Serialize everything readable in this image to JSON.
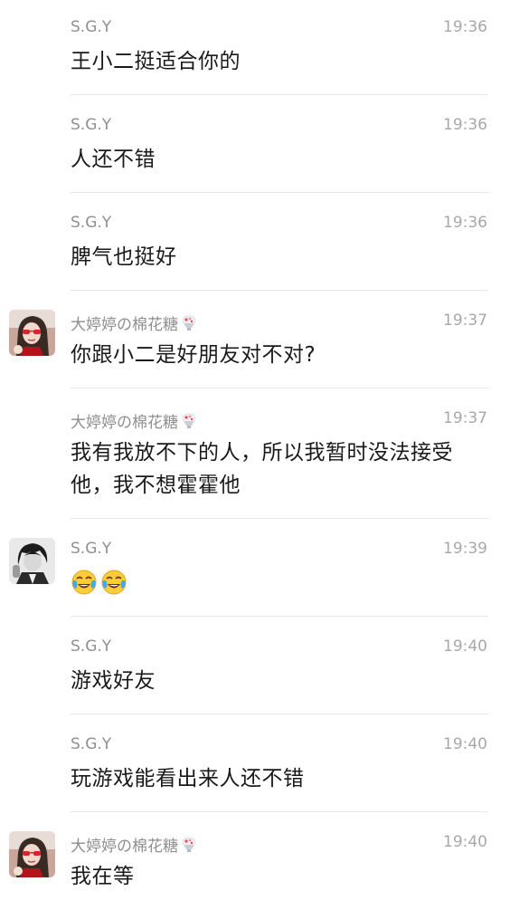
{
  "messages": [
    {
      "sender": "S.G.Y",
      "time": "19:36",
      "text": "王小二挺适合你的"
    },
    {
      "sender": "S.G.Y",
      "time": "19:36",
      "text": "人还不错"
    },
    {
      "sender": "S.G.Y",
      "time": "19:36",
      "text": "脾气也挺好"
    },
    {
      "sender": "大婷婷の棉花糖",
      "time": "19:37",
      "text": "你跟小二是好朋友对不对?"
    },
    {
      "sender": "大婷婷の棉花糖",
      "time": "19:37",
      "text": "我有我放不下的人，所以我暂时没法接受他，我不想霍霍他"
    },
    {
      "sender": "S.G.Y",
      "time": "19:39",
      "emoji": "crying-laughing-emoji x2"
    },
    {
      "sender": "S.G.Y",
      "time": "19:40",
      "text": "游戏好友"
    },
    {
      "sender": "S.G.Y",
      "time": "19:40",
      "text": "玩游戏能看出来人还不错"
    },
    {
      "sender": "大婷婷の棉花糖",
      "time": "19:40",
      "text": "我在等"
    }
  ],
  "icons": {
    "sender_emoji": "shaved-ice-icon",
    "message_emoji": "crying-laughing-face-icon"
  },
  "colors": {
    "name": "#8f8f8f",
    "time": "#a8a8a8",
    "text": "#1a1a1a",
    "divider": "#e6e6e6"
  }
}
